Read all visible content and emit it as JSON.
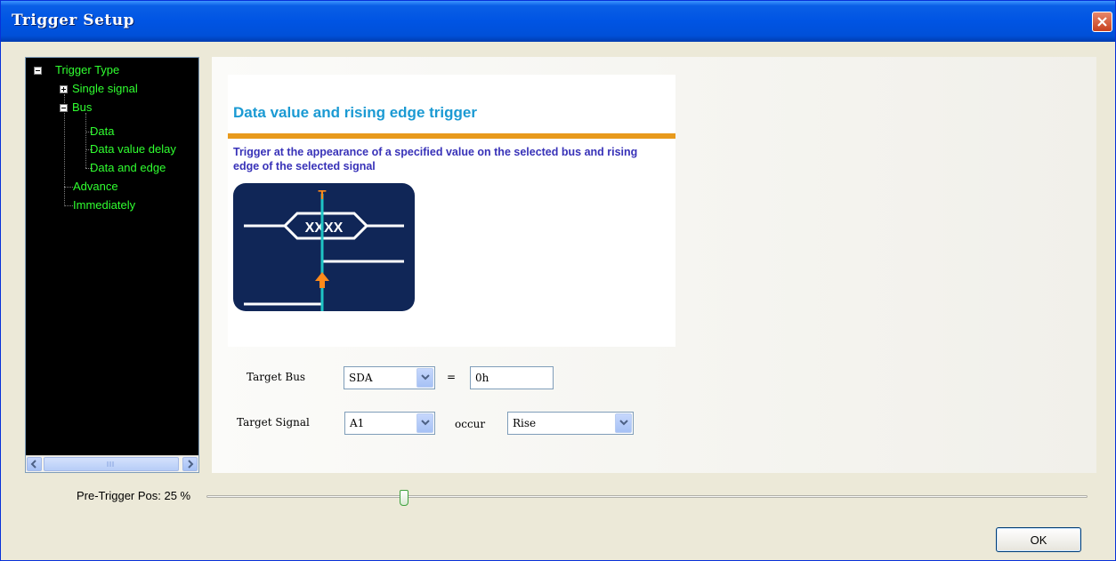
{
  "window": {
    "title": "Trigger Setup"
  },
  "tree": {
    "root": "Trigger Type",
    "items": [
      {
        "label": "Single signal"
      },
      {
        "label": "Bus"
      },
      {
        "label": "Data"
      },
      {
        "label": "Data value delay"
      },
      {
        "label": "Data and edge"
      },
      {
        "label": "Advance"
      },
      {
        "label": "Immediately"
      }
    ]
  },
  "info": {
    "title": "Data value and rising edge trigger",
    "description": "Trigger at the appearance of a specified value on the selected bus and rising edge of the selected signal",
    "diagram_top": "T",
    "diagram_value": "XXXX"
  },
  "form": {
    "target_bus_label": "Target Bus",
    "target_bus_value": "SDA",
    "equals": "=",
    "bus_value": "0h",
    "target_signal_label": "Target Signal",
    "target_signal_value": "A1",
    "occur_label": "occur",
    "occur_value": "Rise"
  },
  "pretrigger": {
    "label": "Pre-Trigger Pos: 25 %",
    "percent": 25
  },
  "buttons": {
    "ok": "OK"
  },
  "colors": {
    "tree_text": "#30ff30",
    "title_blue": "#1b9ad3",
    "accent_orange": "#e89a1c",
    "desc_purple": "#3832b8",
    "diagram_bg": "#102657"
  }
}
